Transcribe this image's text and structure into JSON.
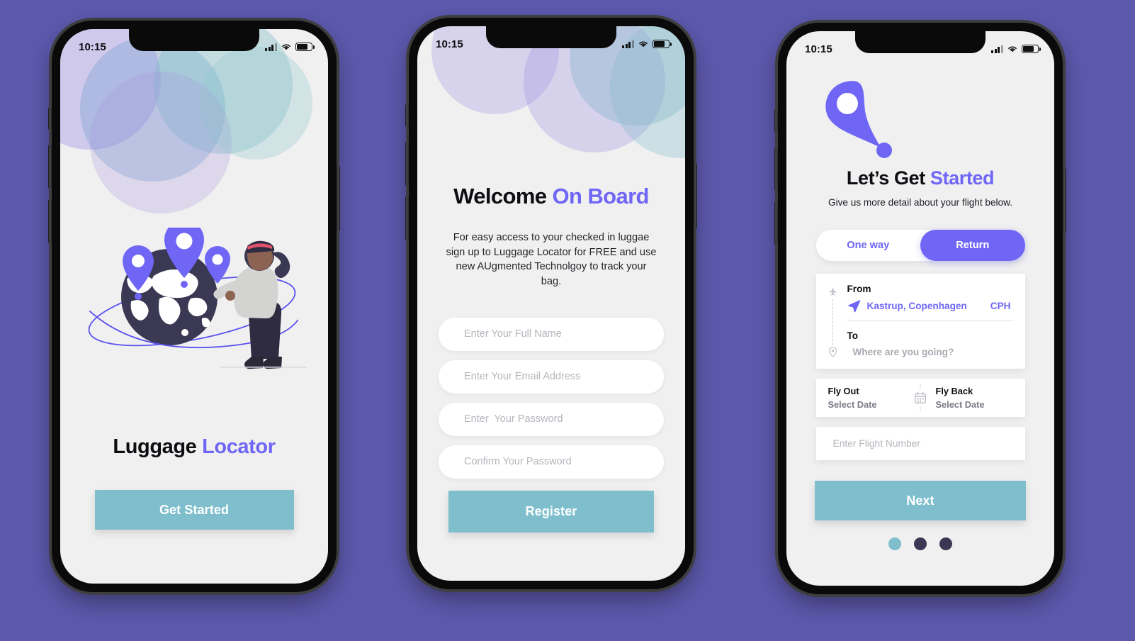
{
  "canvas": {
    "background_color": "#5d59ad",
    "accent_purple": "#6f66f5",
    "accent_teal": "#7fbfcd",
    "dark_navy": "#3a3852"
  },
  "status_bar": {
    "time": "10:15",
    "signal_icon": "signal-bars-icon",
    "wifi_icon": "wifi-icon",
    "battery_icon": "battery-icon"
  },
  "screen_splash": {
    "name": "Splash / Onboarding",
    "illustration": "woman-with-globe-and-location-pins-illustration",
    "brand_primary": "Luggage",
    "brand_accent": "Locator",
    "cta_label": "Get Started"
  },
  "screen_register": {
    "name": "Register",
    "title_primary": "Welcome",
    "title_accent": "On Board",
    "description": "For easy access to your  checked in luggae sign up to Luggage Locator for FREE and use new AUgmented Technolgoy to track your bag.",
    "fields": [
      {
        "name": "full-name-input",
        "placeholder": "Enter Your Full Name",
        "value": ""
      },
      {
        "name": "email-input",
        "placeholder": "Enter Your Email Address",
        "value": ""
      },
      {
        "name": "password-input",
        "placeholder": "Enter  Your Password",
        "value": ""
      },
      {
        "name": "confirm-password-input",
        "placeholder": "Confirm Your Password",
        "value": ""
      }
    ],
    "cta_label": "Register"
  },
  "screen_flight": {
    "name": "Flight Details",
    "pin_icon": "location-pin-icon",
    "title_primary": "Let’s Get",
    "title_accent": "Started",
    "subtitle": "Give us more detail about your flight below.",
    "trip_type": {
      "options": [
        "One way",
        "Return"
      ],
      "selected": "Return"
    },
    "route": {
      "from_label": "From",
      "from_city": "Kastrup, Copenhagen",
      "from_code": "CPH",
      "from_icon": "plane-send-icon",
      "to_label": "To",
      "to_placeholder": "Where are you going?",
      "rail_top_icon": "plane-small-icon",
      "rail_bottom_icon": "map-pin-small-icon"
    },
    "dates": {
      "calendar_icon": "calendar-icon",
      "out_label": "Fly Out",
      "out_value": "Select Date",
      "back_label": "Fly Back",
      "back_value": "Select Date"
    },
    "flight_number": {
      "placeholder": "Enter Flight Number",
      "value": ""
    },
    "cta_label": "Next",
    "pagination": {
      "count": 3,
      "active_index": 0,
      "active_color": "#7fbfcd",
      "inactive_color": "#3a3852"
    }
  }
}
